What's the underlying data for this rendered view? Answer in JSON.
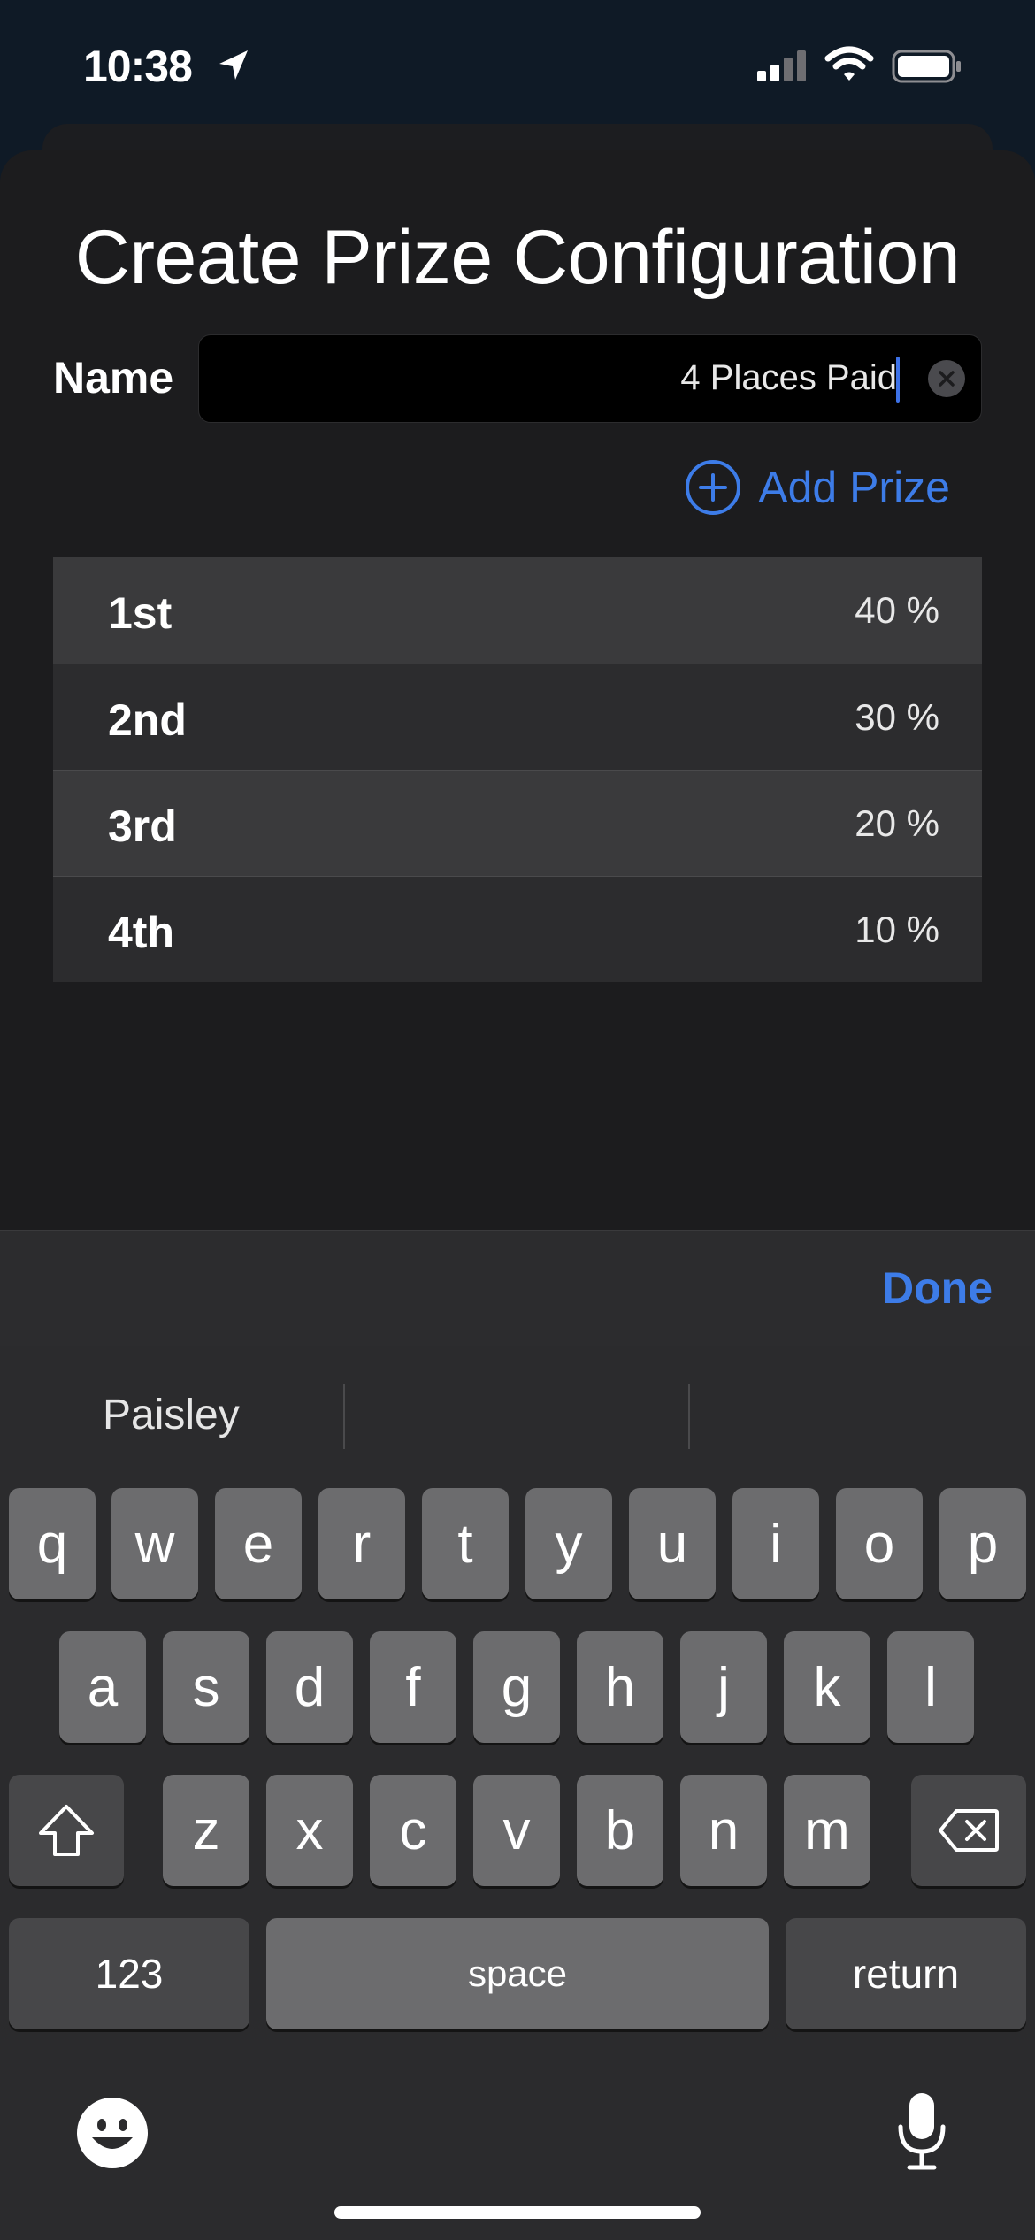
{
  "status_bar": {
    "time": "10:38"
  },
  "sheet": {
    "title": "Create Prize Configuration",
    "name_label": "Name",
    "name_value": "4 Places Paid",
    "add_prize_label": "Add Prize"
  },
  "prizes": [
    {
      "place": "1st",
      "percent": "40 %"
    },
    {
      "place": "2nd",
      "percent": "30 %"
    },
    {
      "place": "3rd",
      "percent": "20 %"
    },
    {
      "place": "4th",
      "percent": "10 %"
    }
  ],
  "keyboard": {
    "done_label": "Done",
    "suggestions": [
      "Paisley",
      "",
      ""
    ],
    "row1": [
      "q",
      "w",
      "e",
      "r",
      "t",
      "y",
      "u",
      "i",
      "o",
      "p"
    ],
    "row2": [
      "a",
      "s",
      "d",
      "f",
      "g",
      "h",
      "j",
      "k",
      "l"
    ],
    "row3": [
      "z",
      "x",
      "c",
      "v",
      "b",
      "n",
      "m"
    ],
    "numbers_label": "123",
    "space_label": "space",
    "return_label": "return"
  },
  "colors": {
    "accent": "#3d7ce8",
    "background": "#1c1c1e"
  }
}
